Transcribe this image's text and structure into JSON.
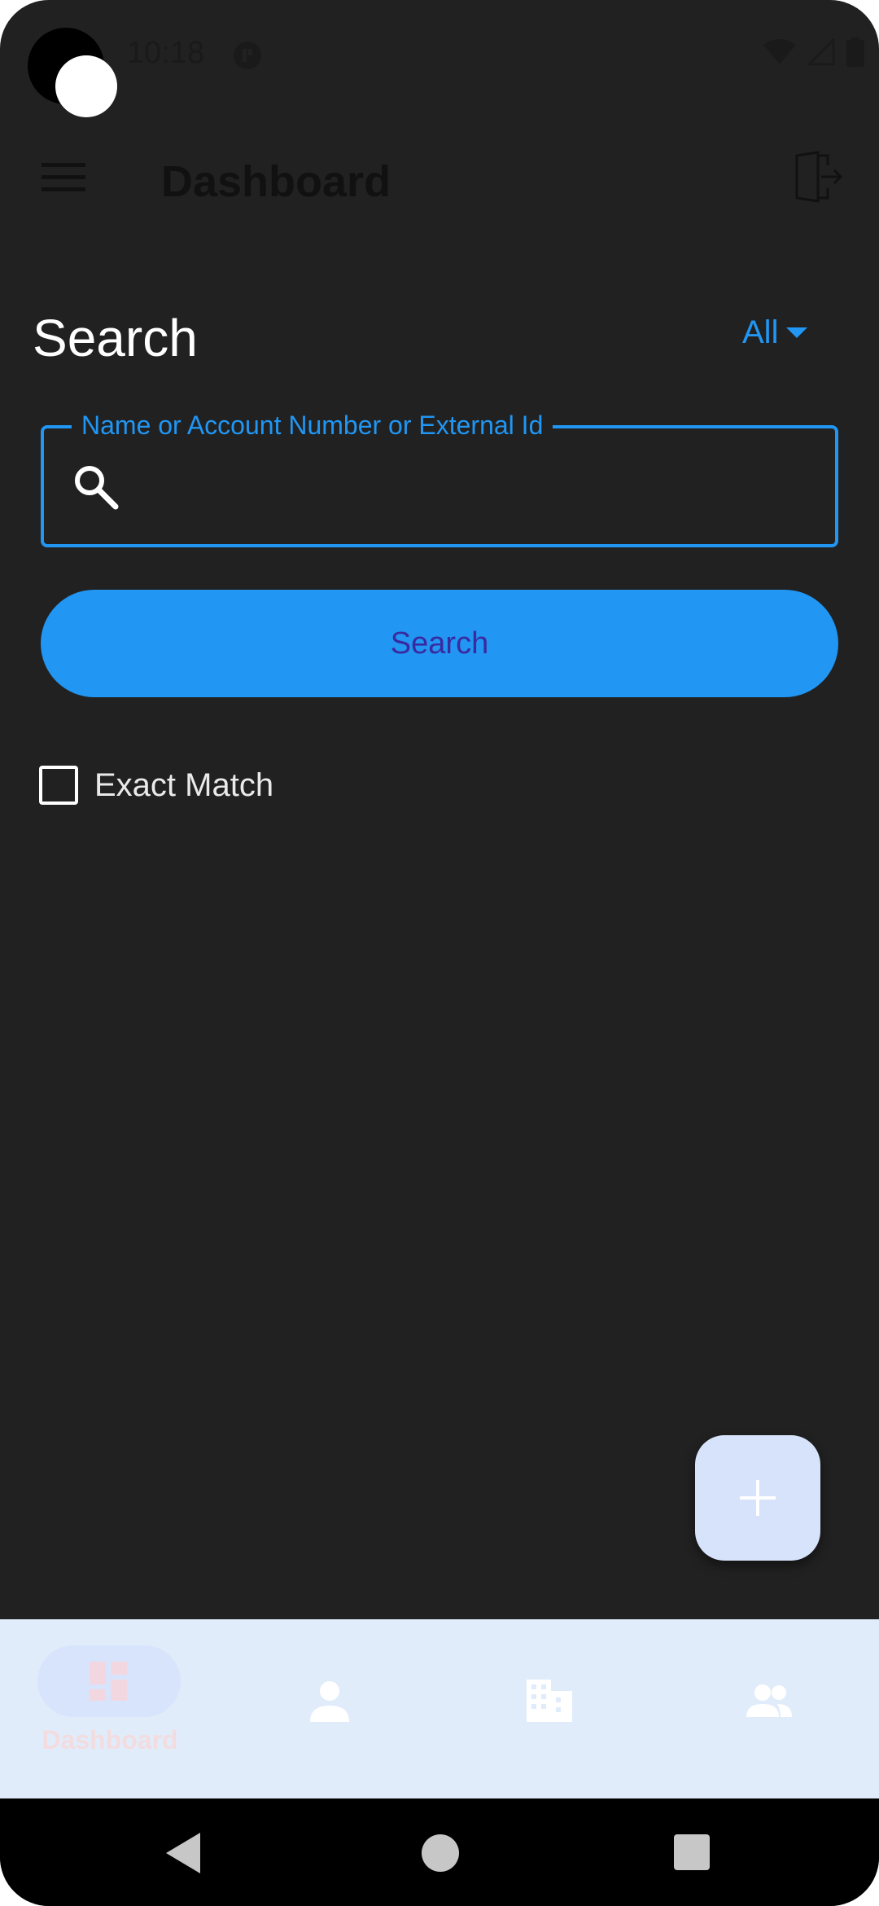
{
  "status_bar": {
    "time": "10:18"
  },
  "app_bar": {
    "title": "Dashboard"
  },
  "search_section": {
    "heading": "Search",
    "filter_value": "All",
    "field_label": "Name or Account Number or External Id",
    "field_value": "",
    "button_label": "Search",
    "exact_match_label": "Exact Match",
    "exact_match_checked": false
  },
  "bottom_nav": {
    "items": [
      {
        "label": "Dashboard",
        "icon": "dashboard-icon",
        "selected": true
      },
      {
        "label": "",
        "icon": "person-icon",
        "selected": false
      },
      {
        "label": "",
        "icon": "business-icon",
        "selected": false
      },
      {
        "label": "",
        "icon": "group-icon",
        "selected": false
      }
    ]
  },
  "colors": {
    "background": "#212121",
    "accent": "#2196f3",
    "fab_background": "#d6e3fb",
    "bottom_nav_background": "#e1ecfb"
  }
}
